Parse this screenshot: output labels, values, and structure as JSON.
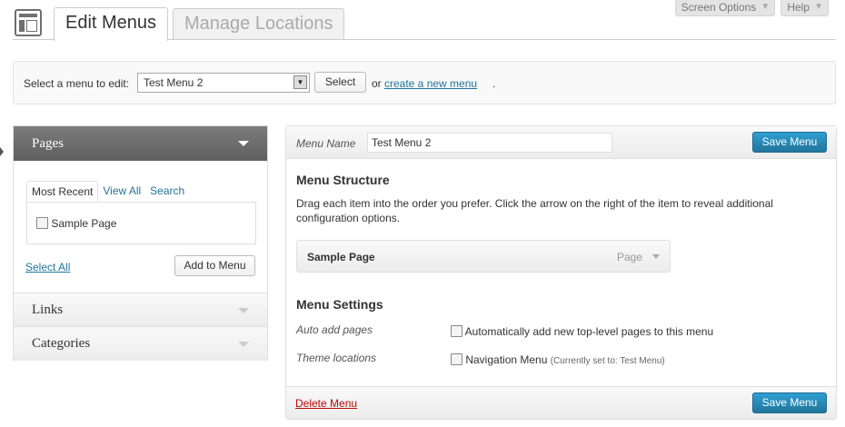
{
  "screen_meta": {
    "screen_options": "Screen Options",
    "help": "Help"
  },
  "tabs": {
    "edit_menus": "Edit Menus",
    "manage_locations": "Manage Locations"
  },
  "manage": {
    "label": "Select a menu to edit:",
    "selected_menu": "Test Menu 2",
    "select_button": "Select",
    "or_text": "or",
    "create_link": "create a new menu",
    "period": "."
  },
  "sidebar": {
    "pages": {
      "title": "Pages",
      "tabs": [
        "Most Recent",
        "View All",
        "Search"
      ],
      "items": [
        "Sample Page"
      ],
      "select_all": "Select All",
      "add_button": "Add to Menu"
    },
    "links": "Links",
    "categories": "Categories"
  },
  "editor": {
    "name_label": "Menu Name",
    "name_value": "Test Menu 2",
    "save_button": "Save Menu",
    "structure_title": "Menu Structure",
    "structure_desc": "Drag each item into the order you prefer. Click the arrow on the right of the item to reveal additional configuration options.",
    "item": {
      "title": "Sample Page",
      "type": "Page"
    },
    "settings_title": "Menu Settings",
    "auto_add_label": "Auto add pages",
    "auto_add_text": "Automatically add new top-level pages to this menu",
    "theme_label": "Theme locations",
    "theme_text": "Navigation Menu",
    "theme_current": "(Currently set to: Test Menu)",
    "delete_link": "Delete Menu"
  }
}
